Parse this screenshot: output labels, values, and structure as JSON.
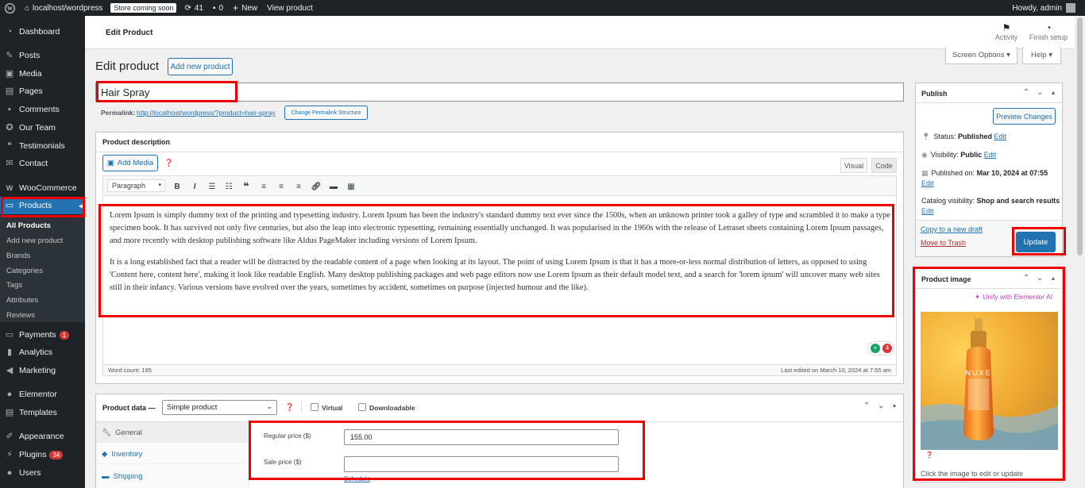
{
  "adminbar": {
    "site": "localhost/wordpress",
    "store_badge": "Store coming soon",
    "updates_count": "41",
    "comments_count": "0",
    "new_label": "New",
    "view_product": "View product",
    "howdy": "Howdy, admin"
  },
  "sidebar": {
    "items": [
      {
        "label": "Dashboard",
        "icon": "dashboard-icon"
      },
      {
        "label": "Posts",
        "icon": "pin-icon"
      },
      {
        "label": "Media",
        "icon": "media-icon"
      },
      {
        "label": "Pages",
        "icon": "pages-icon"
      },
      {
        "label": "Comments",
        "icon": "comment-icon"
      },
      {
        "label": "Our Team",
        "icon": "team-icon"
      },
      {
        "label": "Testimonials",
        "icon": "quote-icon"
      },
      {
        "label": "Contact",
        "icon": "mail-icon"
      },
      {
        "label": "WooCommerce",
        "icon": "woo-icon"
      },
      {
        "label": "Products",
        "icon": "products-icon"
      },
      {
        "label": "Payments",
        "icon": "payments-icon",
        "badge": "1"
      },
      {
        "label": "Analytics",
        "icon": "analytics-icon"
      },
      {
        "label": "Marketing",
        "icon": "megaphone-icon"
      },
      {
        "label": "Elementor",
        "icon": "elementor-icon"
      },
      {
        "label": "Templates",
        "icon": "templates-icon"
      },
      {
        "label": "Appearance",
        "icon": "brush-icon"
      },
      {
        "label": "Plugins",
        "icon": "plugin-icon",
        "badge": "34"
      },
      {
        "label": "Users",
        "icon": "users-icon"
      }
    ],
    "submenu": [
      "All Products",
      "Add new product",
      "Brands",
      "Categories",
      "Tags",
      "Attributes",
      "Reviews"
    ]
  },
  "header": {
    "title": "Edit Product",
    "activity": "Activity",
    "finish_setup": "Finish setup",
    "screen_options": "Screen Options ▾",
    "help": "Help ▾"
  },
  "page": {
    "heading": "Edit product",
    "add_new": "Add new product",
    "product_title": "Hair Spray",
    "permalink_label": "Permalink:",
    "permalink_url": "http://localhost/wordpress/?product=hair-spray",
    "change_permalink": "Change Permalink Structure"
  },
  "description": {
    "title": "Product description",
    "add_media": "Add Media",
    "tab_visual": "Visual",
    "tab_code": "Code",
    "format": "Paragraph",
    "paragraph1": "Lorem Ipsum is simply dummy text of the printing and typesetting industry. Lorem Ipsum has been the industry's standard dummy text ever since the 1500s, when an unknown printer took a galley of type and scrambled it to make a type specimen book. It has survived not only five centuries, but also the leap into electronic typesetting, remaining essentially unchanged. It was popularised in the 1960s with the release of Letraset sheets containing Lorem Ipsum passages, and more recently with desktop publishing software like Aldus PageMaker including versions of Lorem Ipsum.",
    "paragraph2": "It is a long established fact that a reader will be distracted by the readable content of a page when looking at its layout. The point of using Lorem Ipsum is that it has a more-or-less normal distribution of letters, as opposed to using 'Content here, content here', making it look like readable English. Many desktop publishing packages and web page editors now use Lorem Ipsum as their default model text, and a search for 'lorem ipsum' will uncover many web sites still in their infancy. Various versions have evolved over the years, sometimes by accident, sometimes on purpose (injected humour and the like).",
    "word_count": "Word count: 195",
    "last_edited": "Last edited on March 10, 2024 at 7:55 am",
    "grammar_count": "4"
  },
  "product_data": {
    "label": "Product data —",
    "type": "Simple product",
    "virtual": "Virtual",
    "downloadable": "Downloadable",
    "tabs": [
      "General",
      "Inventory",
      "Shipping"
    ],
    "regular_price_label": "Regular price ($)",
    "regular_price": "155.00",
    "sale_price_label": "Sale price ($)",
    "sale_price": "",
    "schedule": "Schedule"
  },
  "publish": {
    "title": "Publish",
    "preview": "Preview Changes",
    "status_label": "Status:",
    "status": "Published",
    "visibility_label": "Visibility:",
    "visibility": "Public",
    "published_on_label": "Published on:",
    "published_on": "Mar 10, 2024 at 07:55",
    "catalog_label": "Catalog visibility:",
    "catalog": "Shop and search results",
    "edit": "Edit",
    "copy_draft": "Copy to a new draft",
    "trash": "Move to Trash",
    "update": "Update"
  },
  "product_image": {
    "title": "Product image",
    "unify": "Unify with Elementor AI",
    "brand": "NUXE",
    "caption": "Click the image to edit or update"
  }
}
